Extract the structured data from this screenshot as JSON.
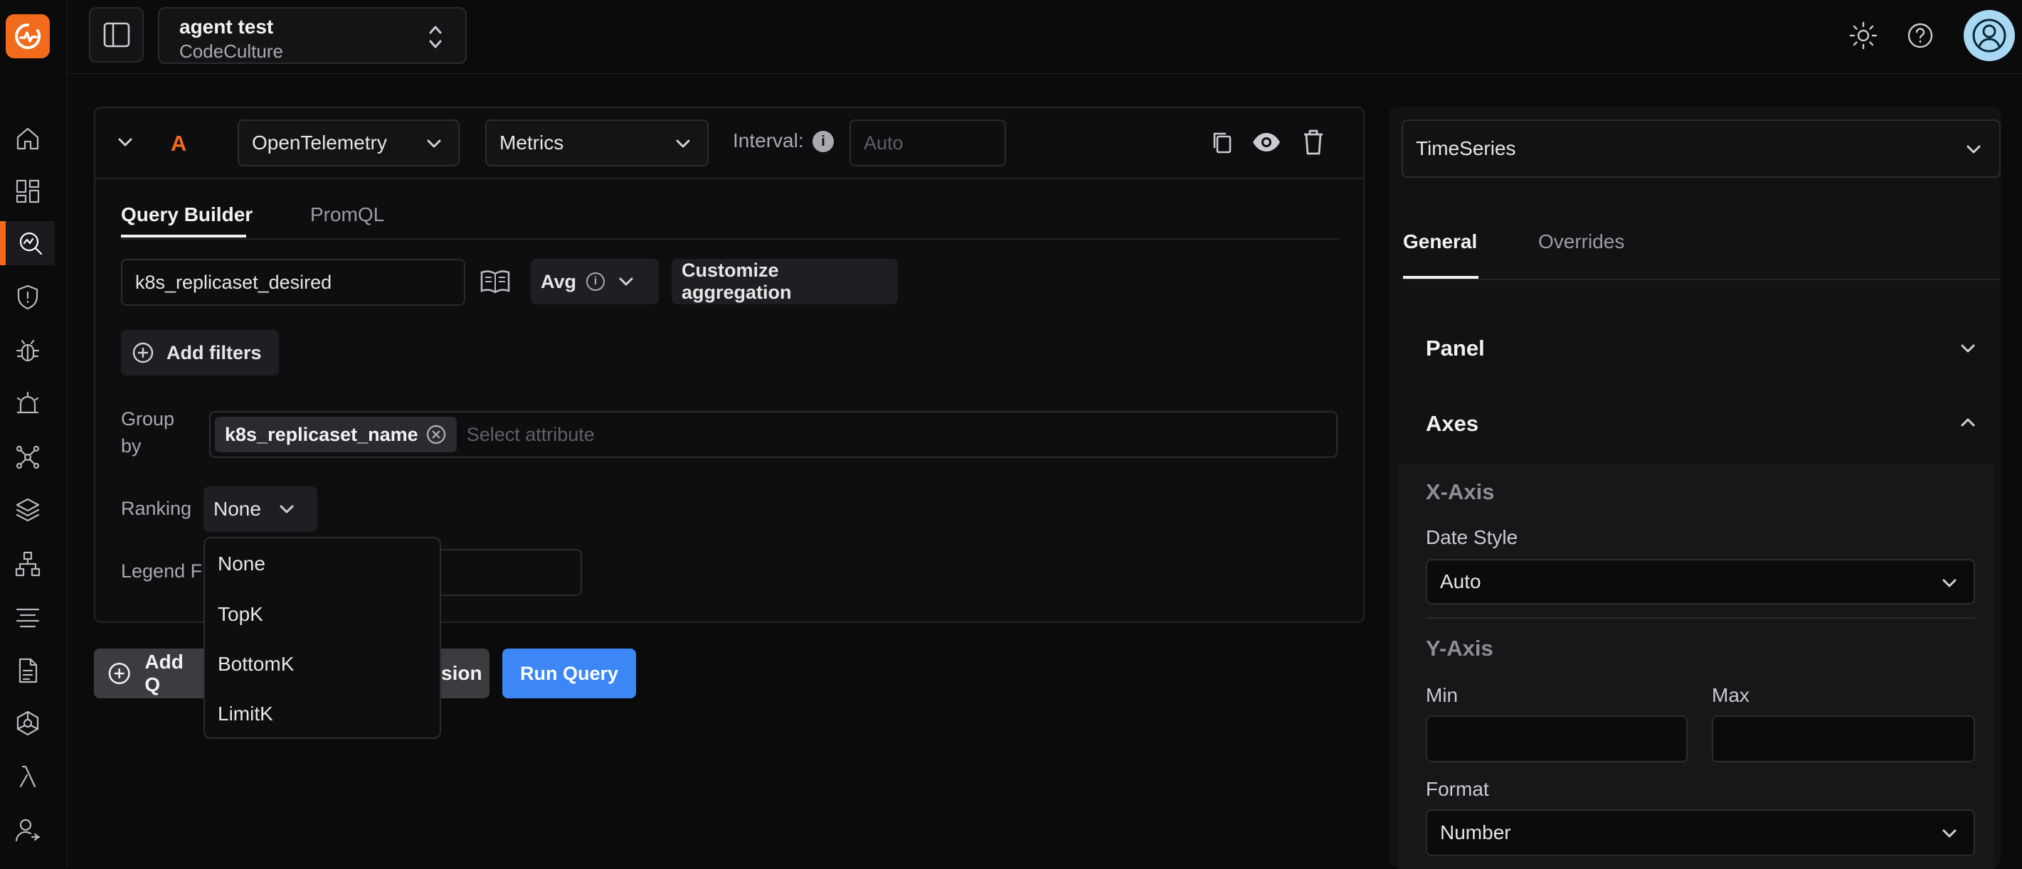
{
  "workspace": {
    "name": "agent test",
    "org": "CodeCulture"
  },
  "sidebar": {
    "items": [
      "home-icon",
      "dashboards-icon",
      "explorer-icon",
      "security-icon",
      "bug-icon",
      "alerts-icon",
      "service-map-icon",
      "layers-icon",
      "hierarchy-icon",
      "logs-icon",
      "document-icon",
      "integrations-icon",
      "lambda-icon",
      "user-settings-icon"
    ],
    "active": "explorer-icon"
  },
  "query": {
    "letter": "A",
    "source": "OpenTelemetry",
    "data_type": "Metrics",
    "interval_label": "Interval:",
    "interval_placeholder": "Auto",
    "tabs": [
      "Query Builder",
      "PromQL"
    ],
    "metric": "k8s_replicaset_desired",
    "aggregation": "Avg",
    "customize_label": "Customize aggregation",
    "add_filters_label": "Add filters",
    "group_by_label_1": "Group",
    "group_by_label_2": "by",
    "group_by_chip": "k8s_replicaset_name",
    "group_by_placeholder": "Select attribute",
    "ranking_label": "Ranking",
    "ranking_value": "None",
    "legend_label": "Legend F",
    "ranking_options": [
      "None",
      "TopK",
      "BottomK",
      "LimitK"
    ]
  },
  "actions": {
    "add_query_label": "Add Q",
    "formula_label": "sion",
    "run_query_label": "Run Query"
  },
  "right_panel": {
    "panel_type": "TimeSeries",
    "tabs": [
      "General",
      "Overrides"
    ],
    "sections": {
      "panel": "Panel",
      "axes": "Axes"
    },
    "x_axis": {
      "title": "X-Axis",
      "date_style_label": "Date Style",
      "date_style_value": "Auto"
    },
    "y_axis": {
      "title": "Y-Axis",
      "min_label": "Min",
      "max_label": "Max",
      "format_label": "Format",
      "format_value": "Number"
    }
  },
  "colors": {
    "accent": "#f26b1d",
    "primary_button": "#3d86f6",
    "background": "#0b0b0c"
  }
}
